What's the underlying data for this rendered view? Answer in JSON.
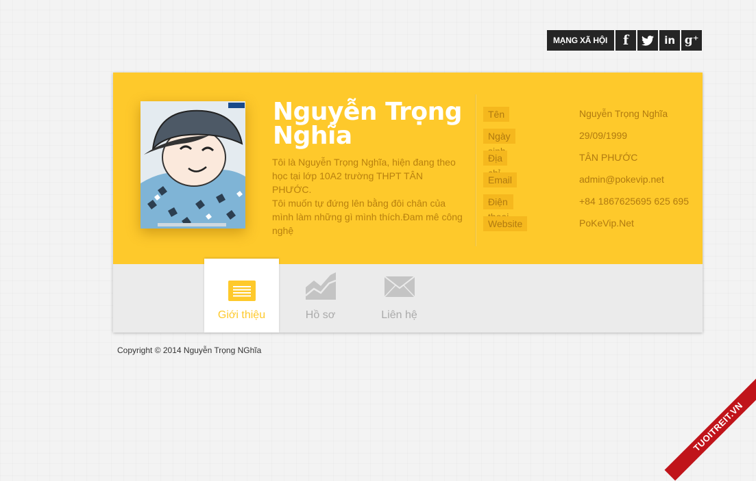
{
  "social": {
    "label": "MẠNG XÃ HỘI",
    "buttons": [
      {
        "icon": "facebook-icon",
        "glyph": "f"
      },
      {
        "icon": "twitter-icon",
        "glyph": ""
      },
      {
        "icon": "linkedin-icon",
        "glyph": "in"
      },
      {
        "icon": "google-plus-icon",
        "glyph": "g⁺"
      }
    ]
  },
  "profile": {
    "name": "Nguyễn Trọng Nghĩa",
    "bio_line1": "Tôi là Nguyễn Trọng Nghĩa, hiện đang theo học tại lớp 10A2 trường THPT TÂN PHƯỚC.",
    "bio_line2": "Tôi muốn tự đứng lên bằng đôi chân của mình làm những gì mình thích.Đam mê công nghệ"
  },
  "info": [
    {
      "label": "Tên",
      "value": "Nguyễn Trọng Nghĩa"
    },
    {
      "label": "Ngày sinh",
      "value": "29/09/1999"
    },
    {
      "label": "Địa chỉ",
      "value": "TÂN PHƯỚC"
    },
    {
      "label": "Email",
      "value": "admin@pokevip.net"
    },
    {
      "label": "Điện thoại",
      "value": "+84 1867625695 625 695"
    },
    {
      "label": "Website",
      "value": "PoKeVip.Net"
    }
  ],
  "tabs": [
    {
      "label": "Giới thiệu",
      "icon": "list-icon",
      "active": true
    },
    {
      "label": "Hồ sơ",
      "icon": "chart-icon",
      "active": false
    },
    {
      "label": "Liên hệ",
      "icon": "envelope-icon",
      "active": false
    }
  ],
  "colors": {
    "accent": "#fec92b",
    "label_bg": "#f5b81e",
    "text_dark": "#b07a10"
  },
  "footer": {
    "copyright": "Copyright © 2014 Nguyễn Trọng NGhĩa"
  },
  "watermark": {
    "text": "TUOITREIT.VN"
  }
}
